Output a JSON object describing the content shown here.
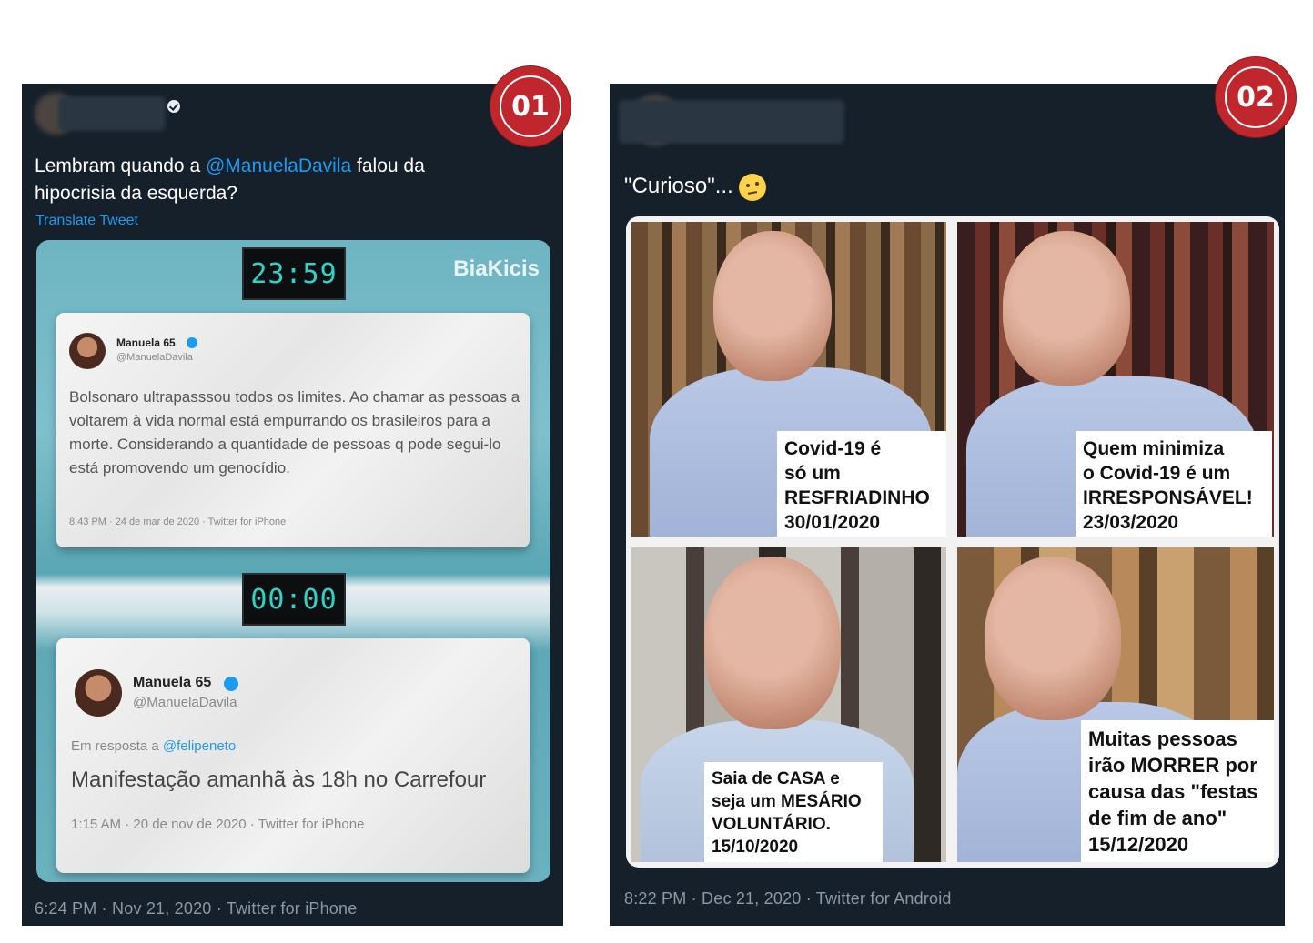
{
  "tweet1": {
    "badge": "01",
    "text_before": "Lembram quando a ",
    "mention": "@ManuelaDavila",
    "text_after": " falou da hipocrisia da esquerda?",
    "translate": "Translate Tweet",
    "image": {
      "clock_top": "23:59",
      "clock_bottom": "00:00",
      "watermark": "BiaKicis",
      "card1": {
        "name": "Manuela 65",
        "handle": "@ManuelaDavila",
        "body": "Bolsonaro ultrapasssou todos os limites. Ao chamar as pessoas a voltarem à vida normal está empurrando os brasileiros para a morte. Considerando a quantidade de pessoas q pode segui-lo está promovendo um genocídio.",
        "meta": "8:43 PM · 24 de mar de 2020 · Twitter for iPhone"
      },
      "card2": {
        "name": "Manuela 65",
        "handle": "@ManuelaDavila",
        "reply_prefix": "Em resposta a ",
        "reply_mention": "@felipeneto",
        "body": "Manifestação amanhã às 18h no Carrefour",
        "meta": "1:15 AM · 20 de nov de 2020 · Twitter for iPhone"
      }
    },
    "footer": "6:24 PM · Nov 21, 2020 · Twitter for iPhone"
  },
  "tweet2": {
    "badge": "02",
    "text": "\"Curioso\"...",
    "emoji": "thinking-face",
    "captions": [
      [
        "Covid-19 é",
        "só um",
        "RESFRIADINHO",
        "30/01/2020"
      ],
      [
        "Quem minimiza",
        "o Covid-19 é  um",
        "IRRESPONSÁVEL!",
        "23/03/2020"
      ],
      [
        "Saia de CASA e",
        "seja um MESÁRIO",
        "VOLUNTÁRIO.",
        "15/10/2020"
      ],
      [
        "Muitas pessoas",
        "irão  MORRER por",
        "causa das \"festas",
        "de fim de ano\"",
        "15/12/2020"
      ]
    ],
    "footer": "8:22 PM · Dec 21, 2020 · Twitter for Android"
  },
  "colors": {
    "tweet_bg": "#15202b",
    "link": "#1d9bf0",
    "badge_red": "#c0272d",
    "muted": "#8b98a5"
  }
}
